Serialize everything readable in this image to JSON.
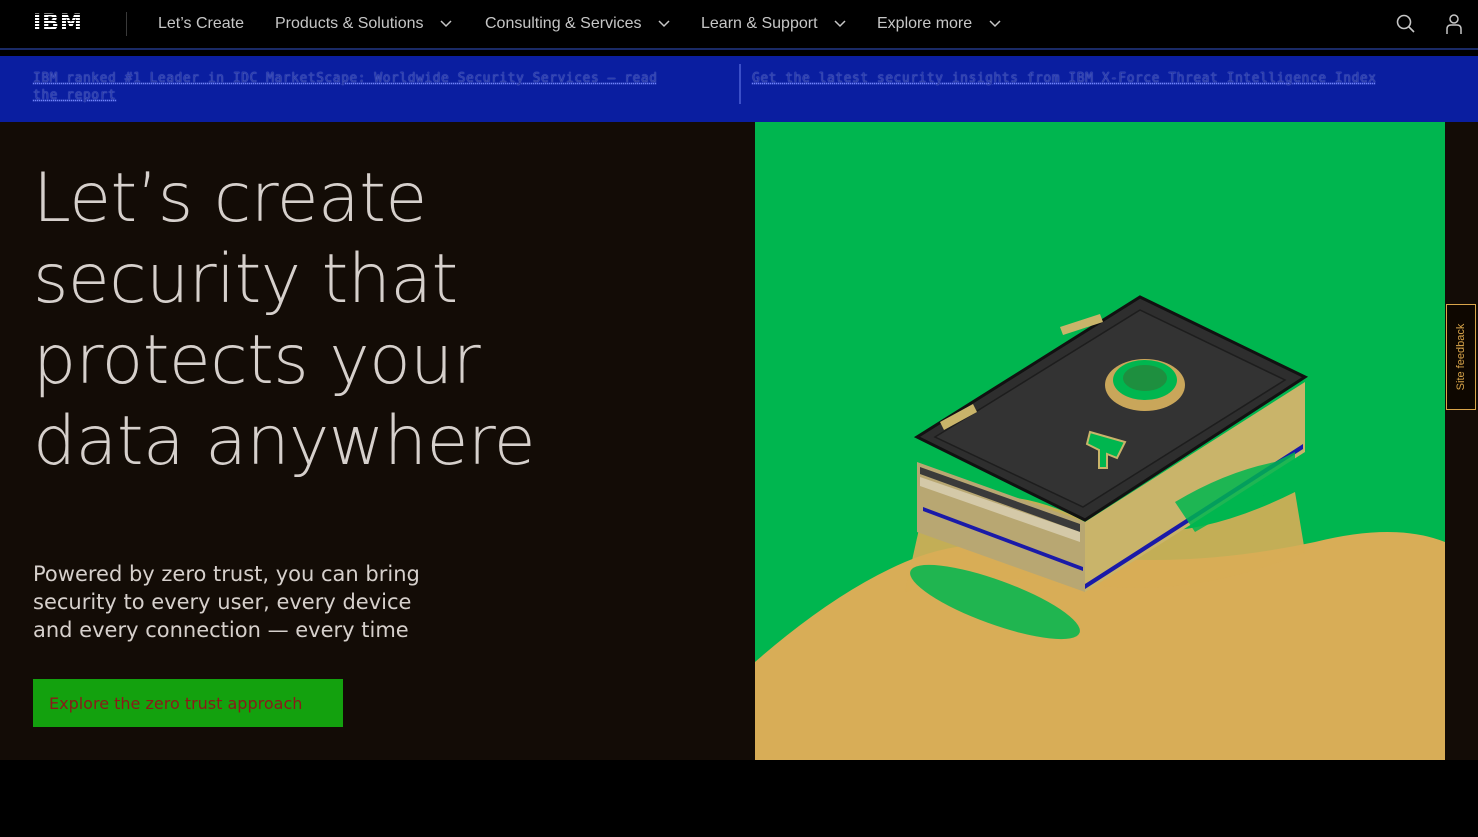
{
  "nav": {
    "logo": "IBM",
    "items": [
      {
        "label": "Let’s Create",
        "dropdown": false
      },
      {
        "label": "Products & Solutions",
        "dropdown": true
      },
      {
        "label": "Consulting & Services",
        "dropdown": true
      },
      {
        "label": "Learn & Support",
        "dropdown": true
      },
      {
        "label": "Explore more",
        "dropdown": true
      }
    ],
    "icons": [
      "search-icon",
      "user-icon"
    ]
  },
  "banner": {
    "left_text": "IBM ranked #1 Leader in IDC MarketScape: Worldwide Security Services — read the report",
    "right_text": "Get the latest security insights from IBM X-Force Threat Intelligence Index"
  },
  "hero": {
    "headline": "Let’s create security that protects your data anywhere",
    "subcopy": "Powered by zero trust, you can bring security to every user, every device and every connection — every time",
    "cta_label": "Explore the zero trust approach"
  },
  "feedback": {
    "label": "Site feedback"
  },
  "colors": {
    "hero_bg": "#130c06",
    "banner_bg": "#0a1ea0",
    "cta_bg": "#13a10e",
    "image_bg": "#00b64f",
    "floor": "#d8ad57"
  }
}
